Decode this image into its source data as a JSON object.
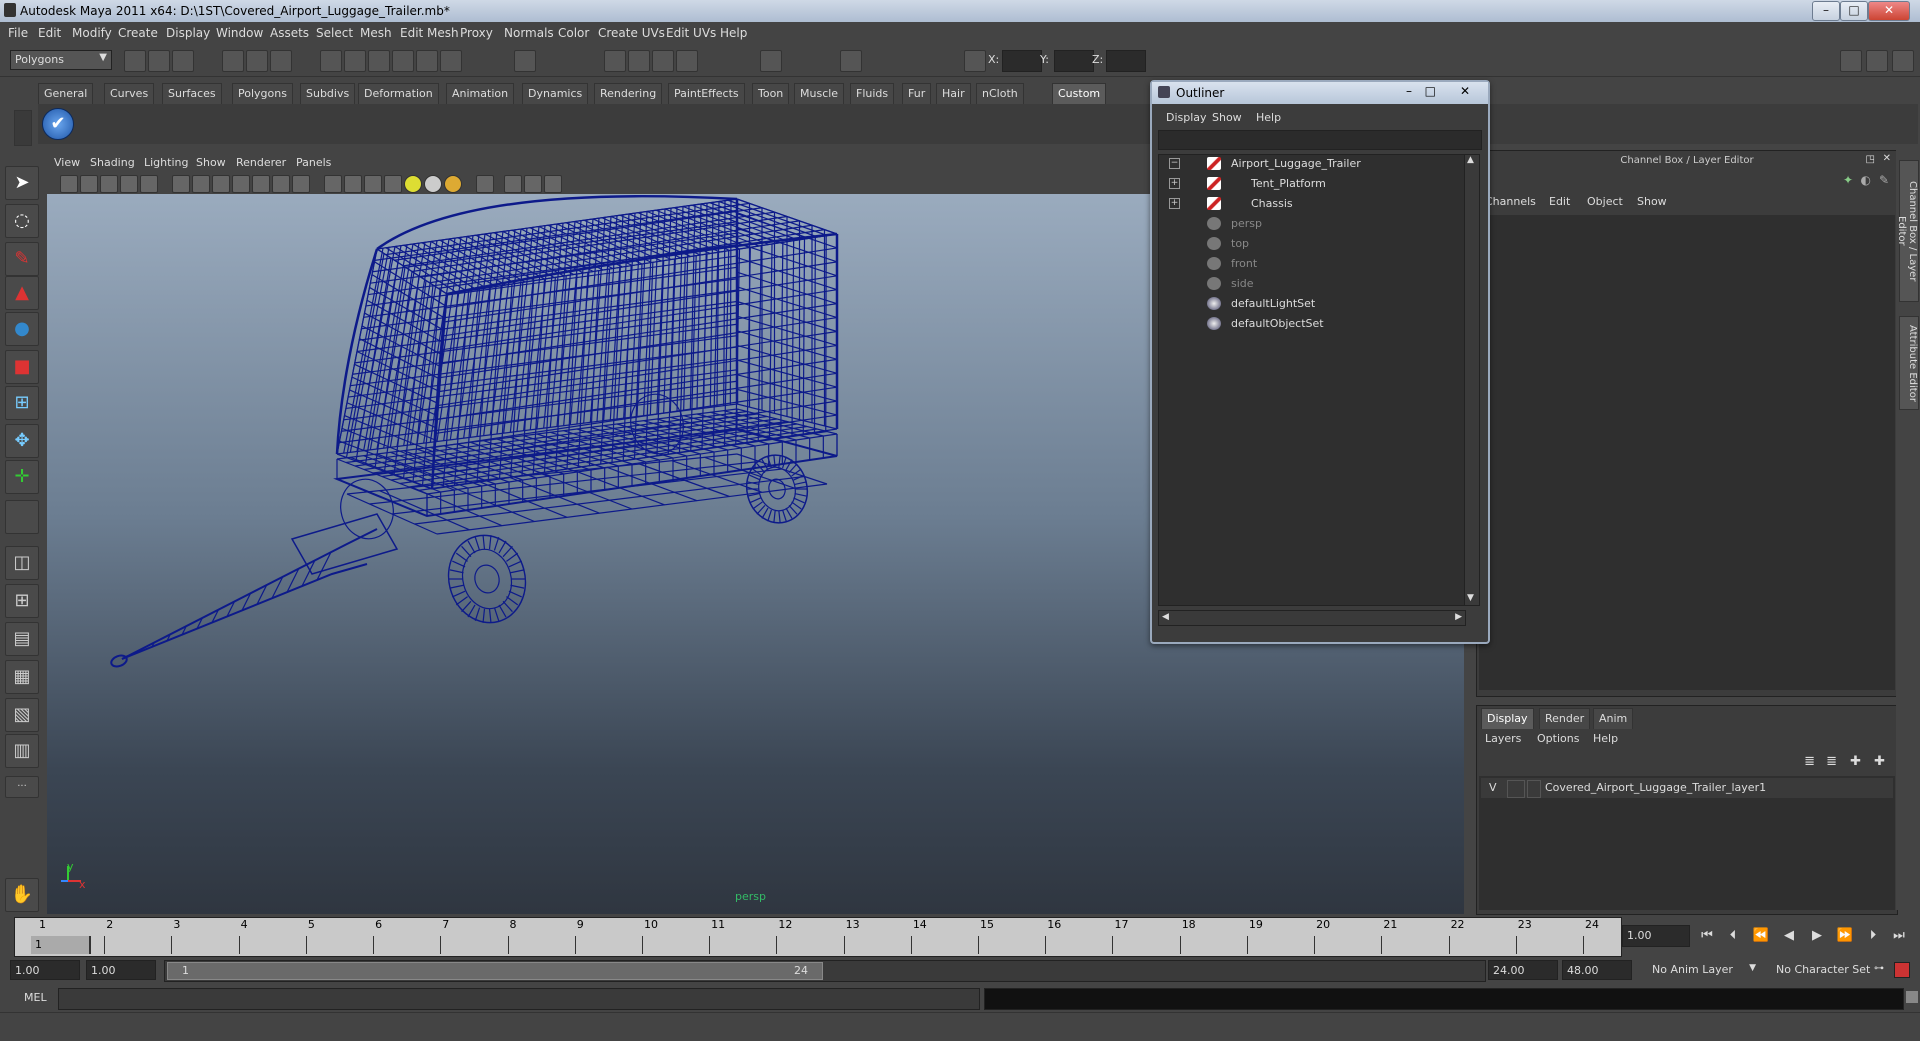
{
  "window": {
    "title": "Autodesk Maya 2011 x64: D:\\1ST\\Covered_Airport_Luggage_Trailer.mb*",
    "minimize": "–",
    "maximize": "□",
    "close": "✕"
  },
  "menubar": [
    "File",
    "Edit",
    "Modify",
    "Create",
    "Display",
    "Window",
    "Assets",
    "Select",
    "Mesh",
    "Edit Mesh",
    "Proxy",
    "Normals",
    "Color",
    "Create UVs",
    "Edit UVs",
    "Help"
  ],
  "statusline": {
    "mode": "Polygons",
    "x_label": "X:",
    "y_label": "Y:",
    "z_label": "Z:"
  },
  "shelf_tabs": [
    "General",
    "Curves",
    "Surfaces",
    "Polygons",
    "Subdivs",
    "Deformation",
    "Animation",
    "Dynamics",
    "Rendering",
    "PaintEffects",
    "Toon",
    "Muscle",
    "Fluids",
    "Fur",
    "Hair",
    "nCloth",
    "Custom"
  ],
  "shelf_active": "Custom",
  "viewport": {
    "menu": [
      "View",
      "Shading",
      "Lighting",
      "Show",
      "Renderer",
      "Panels"
    ],
    "camera_label": "persp",
    "axis_y": "y",
    "axis_x": "x",
    "wire_color": "#0d1a8a"
  },
  "outliner": {
    "title": "Outliner",
    "menu": [
      "Display",
      "Show",
      "Help"
    ],
    "items": [
      {
        "label": "Airport_Luggage_Trailer",
        "type": "transform",
        "expand": "−",
        "dimmed": false
      },
      {
        "label": "Tent_Platform",
        "type": "transform",
        "expand": "+",
        "dimmed": false
      },
      {
        "label": "Chassis",
        "type": "transform",
        "expand": "+",
        "dimmed": false
      },
      {
        "label": "persp",
        "type": "camera",
        "expand": "",
        "dimmed": true
      },
      {
        "label": "top",
        "type": "camera",
        "expand": "",
        "dimmed": true
      },
      {
        "label": "front",
        "type": "camera",
        "expand": "",
        "dimmed": true
      },
      {
        "label": "side",
        "type": "camera",
        "expand": "",
        "dimmed": true
      },
      {
        "label": "defaultLightSet",
        "type": "set",
        "expand": "",
        "dimmed": false
      },
      {
        "label": "defaultObjectSet",
        "type": "set",
        "expand": "",
        "dimmed": false
      }
    ]
  },
  "channelbox": {
    "title": "Channel Box / Layer Editor",
    "menu": [
      "Channels",
      "Edit",
      "Object",
      "Show"
    ]
  },
  "layereditor": {
    "tabs": [
      "Display",
      "Render",
      "Anim"
    ],
    "active_tab": "Display",
    "menu": [
      "Layers",
      "Options",
      "Help"
    ],
    "layer": {
      "visible": "V",
      "name": "Covered_Airport_Luggage_Trailer_layer1"
    }
  },
  "side_tabs": [
    "Channel Box / Layer Editor",
    "Attribute Editor"
  ],
  "timeline": {
    "ticks": [
      "1",
      "2",
      "3",
      "4",
      "5",
      "6",
      "7",
      "8",
      "9",
      "10",
      "11",
      "12",
      "13",
      "14",
      "15",
      "16",
      "17",
      "18",
      "19",
      "20",
      "21",
      "22",
      "23",
      "24"
    ],
    "current_frame_marker": "1",
    "current_time": "1.00"
  },
  "range": {
    "start": "1.00",
    "playback_start": "1.00",
    "slider_start": "1",
    "slider_end": "24",
    "playback_end": "24.00",
    "end": "48.00",
    "anim_layer": "No Anim Layer",
    "character_set": "No Character Set"
  },
  "cmdline": {
    "label": "MEL"
  }
}
